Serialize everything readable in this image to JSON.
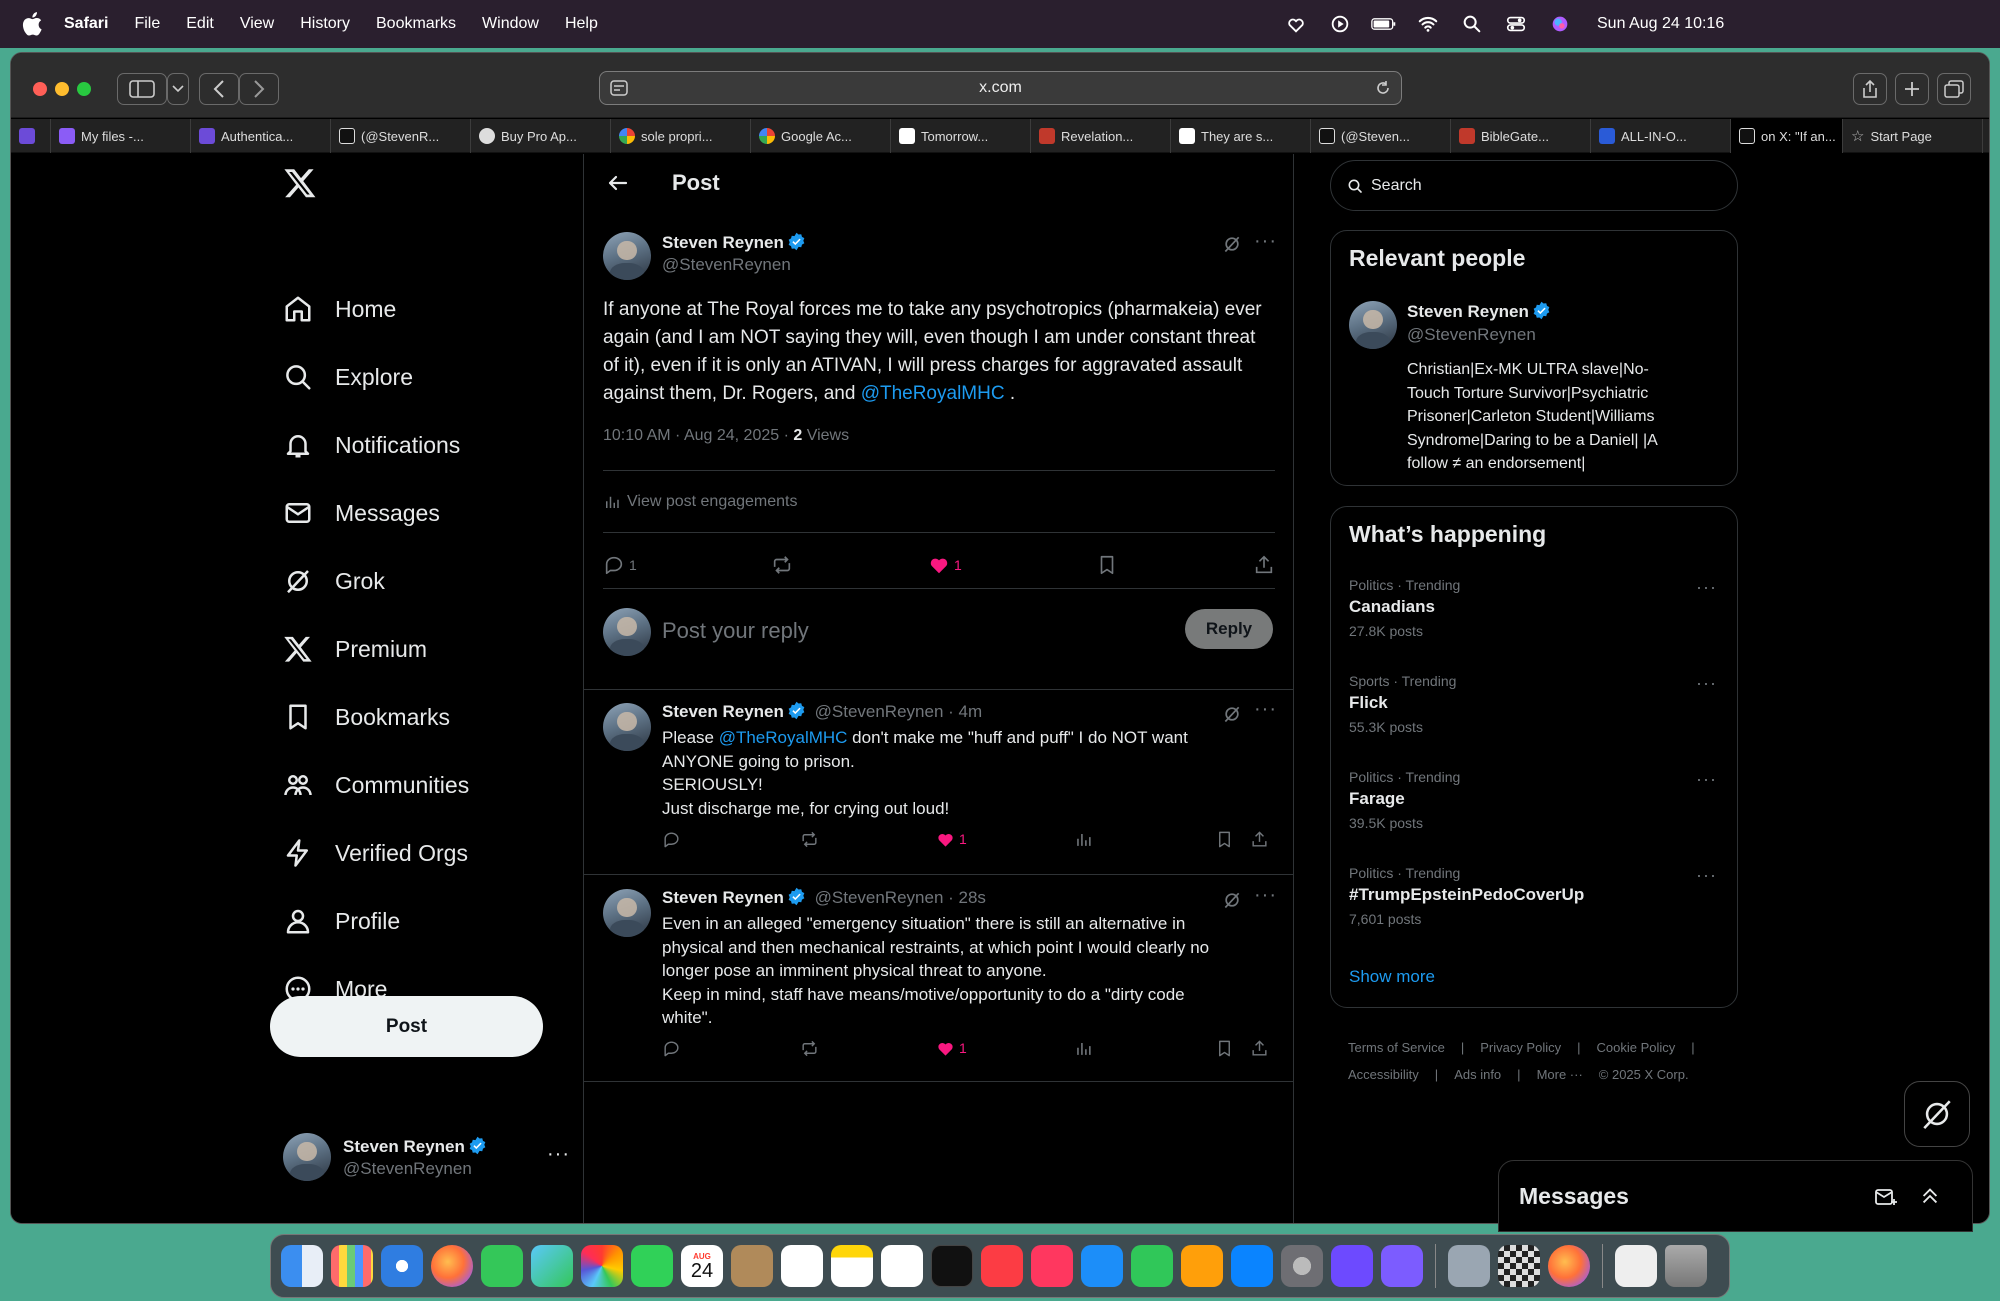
{
  "menubar": {
    "app": "Safari",
    "items": [
      "File",
      "Edit",
      "View",
      "History",
      "Bookmarks",
      "Window",
      "Help"
    ],
    "clock": "Sun Aug 24  10:16"
  },
  "browser": {
    "url": "x.com",
    "tabs": [
      {
        "label": "",
        "color": "#6c4bd8"
      },
      {
        "label": "My files -...",
        "color": "#8b5cf6"
      },
      {
        "label": "Authentica...",
        "color": "#6c4bd8"
      },
      {
        "label": "(@StevenR...",
        "color": "#111111"
      },
      {
        "label": "Buy Pro Ap...",
        "color": "#222222"
      },
      {
        "label": "sole propri...",
        "color": "#ea4335"
      },
      {
        "label": "Google Ac...",
        "color": "#4285f4"
      },
      {
        "label": "Tomorrow...",
        "color": "#ffffff"
      },
      {
        "label": "Revelation...",
        "color": "#c0392b"
      },
      {
        "label": "They are s...",
        "color": "#ffffff"
      },
      {
        "label": "(@Steven...",
        "color": "#111111"
      },
      {
        "label": "BibleGate...",
        "color": "#c0392b"
      },
      {
        "label": "ALL-IN-O...",
        "color": "#2a5bd7"
      },
      {
        "label": "on X: \"If an...",
        "color": "#111111"
      },
      {
        "label": "Start Page",
        "color": "#888888"
      }
    ]
  },
  "nav": {
    "items": [
      "Home",
      "Explore",
      "Notifications",
      "Messages",
      "Grok",
      "Premium",
      "Bookmarks",
      "Communities",
      "Verified Orgs",
      "Profile",
      "More"
    ],
    "post_button": "Post",
    "account": {
      "name": "Steven Reynen",
      "handle": "@StevenReynen"
    }
  },
  "main": {
    "header_title": "Post",
    "post": {
      "name": "Steven Reynen",
      "handle": "@StevenReynen",
      "text_before": "If anyone at The Royal forces me to take any psychotropics (pharmakeia) ever again (and I am NOT saying they will, even though I am under constant threat of it), even if it is only an ATIVAN, I will press charges for aggravated assault against them, Dr. Rogers, and ",
      "mention": "@TheRoyalMHC",
      "text_after": " .",
      "timestamp": "10:10 AM · Aug 24, 2025 · ",
      "views_count": "2",
      "views_label": "Views",
      "engagements": "View post engagements",
      "replies": "1",
      "likes": "1"
    },
    "reply_placeholder": "Post your reply",
    "reply_button": "Reply",
    "replies": [
      {
        "name": "Steven Reynen",
        "handle": "@StevenReynen",
        "time": "· 4m",
        "prefix": "Please ",
        "mention": "@TheRoyalMHC",
        "lines": [
          " don't make me \"huff and puff\" I do NOT want",
          "ANYONE going to prison.",
          "SERIOUSLY!",
          "Just discharge me, for crying out loud!"
        ],
        "likes": "1"
      },
      {
        "name": "Steven Reynen",
        "handle": "@StevenReynen",
        "time": "· 28s",
        "lines": [
          "Even in an alleged \"emergency situation\" there is still an alternative in",
          "physical and then mechanical restraints, at which point I would clearly no",
          "longer pose an imminent physical threat to anyone.",
          "Keep in mind, staff have means/motive/opportunity to do a \"dirty code",
          "white\"."
        ],
        "likes": "1"
      }
    ]
  },
  "sidebar": {
    "search_placeholder": "Search",
    "relevant": {
      "title": "Relevant people",
      "name": "Steven Reynen",
      "handle": "@StevenReynen",
      "bio": [
        "Christian|Ex-MK ULTRA slave|No-",
        "Touch Torture Survivor|Psychiatric",
        "Prisoner|Carleton Student|Williams",
        "Syndrome|Daring to be a Daniel| |A",
        "follow ≠ an endorsement|"
      ]
    },
    "happening": {
      "title": "What’s happening",
      "trends": [
        {
          "category": "Politics · Trending",
          "name": "Canadians",
          "count": "27.8K posts"
        },
        {
          "category": "Sports · Trending",
          "name": "Flick",
          "count": "55.3K posts"
        },
        {
          "category": "Politics · Trending",
          "name": "Farage",
          "count": "39.5K posts"
        },
        {
          "category": "Politics · Trending",
          "name": "#TrumpEpsteinPedoCoverUp",
          "count": "7,601 posts"
        }
      ],
      "show_more": "Show more"
    },
    "footer": [
      "Terms of Service",
      "|",
      "Privacy Policy",
      "|",
      "Cookie Policy",
      "|",
      "Accessibility",
      "|",
      "Ads info",
      "|",
      "More ···",
      "© 2025 X Corp."
    ]
  },
  "messages_drawer": {
    "title": "Messages"
  },
  "dock": {
    "apps": [
      {
        "name": "finder",
        "color": "#3b8ef0"
      },
      {
        "name": "launchpad",
        "color": "#8a8a8a"
      },
      {
        "name": "safari",
        "color": "#2f7de1"
      },
      {
        "name": "firefox",
        "color": "#ff7139"
      },
      {
        "name": "messages",
        "color": "#34c759"
      },
      {
        "name": "maps",
        "color": "#5ac8fa"
      },
      {
        "name": "photos",
        "color": "#f5a623"
      },
      {
        "name": "facetime",
        "color": "#30d158"
      },
      {
        "name": "calendar",
        "color": "#ffffff"
      },
      {
        "name": "contacts",
        "color": "#b08a5a"
      },
      {
        "name": "reminders",
        "color": "#ffffff"
      },
      {
        "name": "notes",
        "color": "#ffd60a"
      },
      {
        "name": "freeform",
        "color": "#ffffff"
      },
      {
        "name": "tv",
        "color": "#111111"
      },
      {
        "name": "music",
        "color": "#fc3c44"
      },
      {
        "name": "news",
        "color": "#ff375f"
      },
      {
        "name": "keynote",
        "color": "#1c8ef9"
      },
      {
        "name": "numbers",
        "color": "#30c759"
      },
      {
        "name": "pages",
        "color": "#ff9f0a"
      },
      {
        "name": "app-store",
        "color": "#0a84ff"
      },
      {
        "name": "system-settings",
        "color": "#8e8e93"
      },
      {
        "name": "proton-vpn",
        "color": "#6d4aff"
      },
      {
        "name": "proton-mail",
        "color": "#7c5cff"
      },
      {
        "name": "preview",
        "color": "#9aa6b2"
      },
      {
        "name": "chess",
        "color": "#cccccc"
      },
      {
        "name": "firefox-2",
        "color": "#ff7139"
      },
      {
        "name": "document",
        "color": "#eeeeee"
      },
      {
        "name": "trash",
        "color": "#9a9a9a"
      }
    ],
    "calendar_day": "24",
    "calendar_month": "AUG"
  }
}
